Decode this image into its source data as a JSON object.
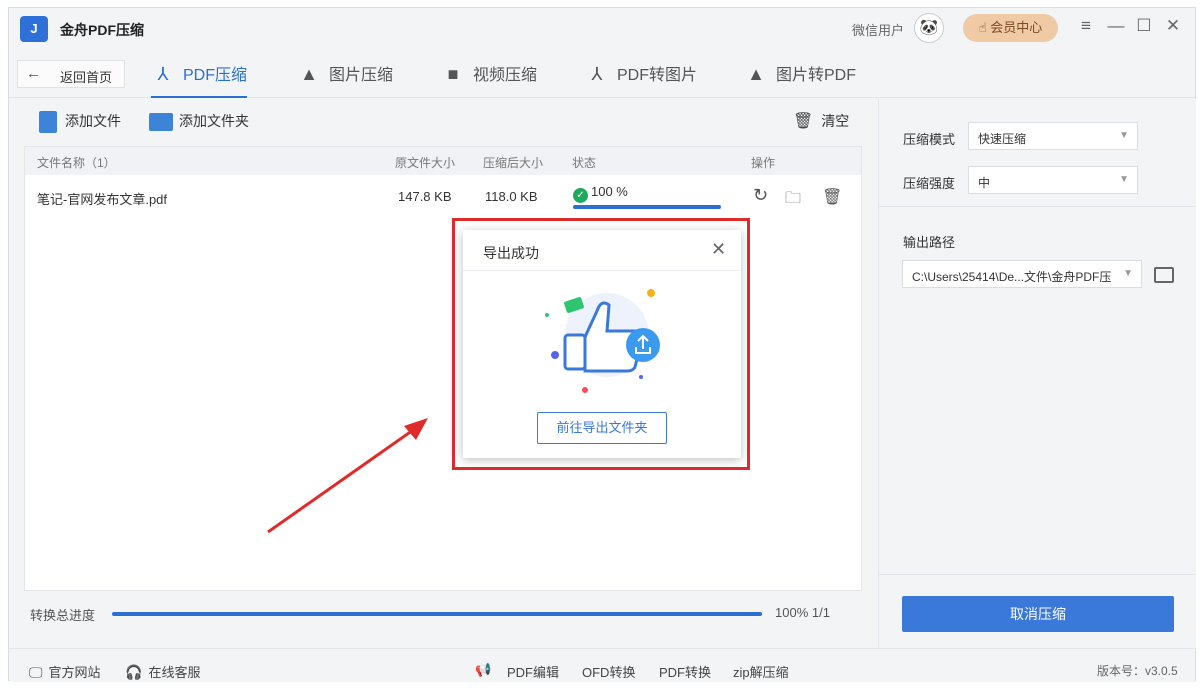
{
  "app": {
    "title": "金舟PDF压缩",
    "logo_text": "J",
    "user_name": "微信用户",
    "vip_label": "会员中心",
    "window_controls": [
      "menu-icon",
      "minimize-icon",
      "maximize-icon",
      "close-icon"
    ]
  },
  "nav": {
    "back_label": "返回首页",
    "tabs": [
      {
        "label": "PDF压缩",
        "icon": "pdf-compress-icon",
        "active": true
      },
      {
        "label": "图片压缩",
        "icon": "image-compress-icon",
        "active": false
      },
      {
        "label": "视频压缩",
        "icon": "video-compress-icon",
        "active": false
      },
      {
        "label": "PDF转图片",
        "icon": "pdf-to-image-icon",
        "active": false
      },
      {
        "label": "图片转PDF",
        "icon": "image-to-pdf-icon",
        "active": false
      }
    ]
  },
  "toolbar": {
    "add_file": "添加文件",
    "add_folder": "添加文件夹",
    "clear": "清空"
  },
  "table": {
    "columns": [
      "文件名称（1）",
      "原文件大小",
      "压缩后大小",
      "状态",
      "操作"
    ],
    "rows": [
      {
        "name": "笔记-官网发布文章.pdf",
        "original_size": "147.8 KB",
        "compressed_size": "118.0 KB",
        "status": "100 %",
        "progress": 1.0
      }
    ]
  },
  "progress": {
    "label": "转换总进度",
    "value_text": "100% 1/1",
    "fraction": 1.0
  },
  "settings": {
    "mode_label": "压缩模式",
    "mode_value": "快速压缩",
    "strength_label": "压缩强度",
    "strength_value": "中",
    "output_label": "输出路径",
    "output_value": "C:\\Users\\25414\\De...文件\\金舟PDF压",
    "cancel_button": "取消压缩"
  },
  "footer": {
    "website": "官方网站",
    "support": "在线客服",
    "links": [
      "PDF编辑",
      "OFD转换",
      "PDF转换",
      "zip解压缩"
    ],
    "version": "版本号：v3.0.5"
  },
  "dialog": {
    "title": "导出成功",
    "button": "前往导出文件夹"
  },
  "colors": {
    "accent": "#2b6fd1",
    "success": "#1fa95f",
    "highlight": "#e02b2b",
    "vip": "#f0c9a5"
  }
}
